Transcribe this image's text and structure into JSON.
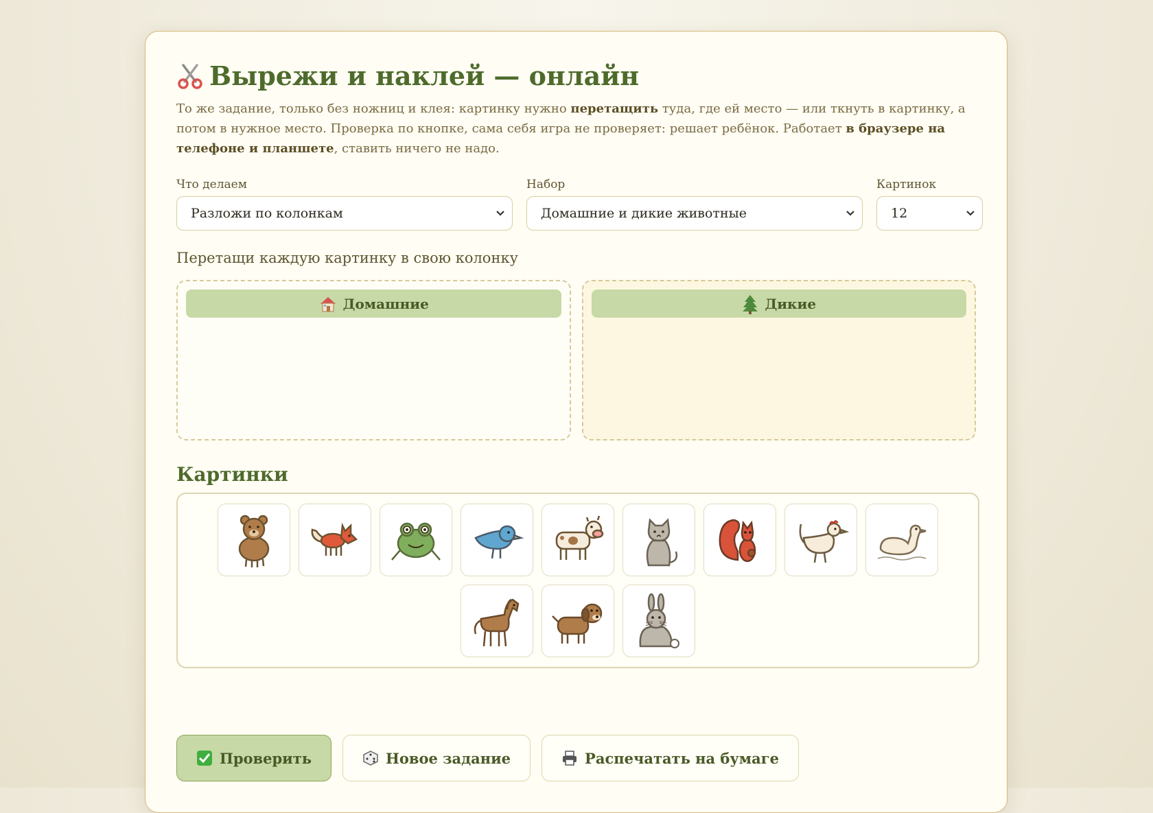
{
  "header": {
    "title": "Вырежи и наклей — онлайн",
    "icon": "scissors-icon"
  },
  "intro": {
    "p1": "То же задание, только без ножниц и клея: картинку нужно ",
    "b1": "перетащить",
    "p2": " туда, где ей место — или ткнуть в картинку, а потом в нужное место. Проверка по кнопке, сама себя игра не проверяет: решает ребёнок. Работает ",
    "b2": "в браузере на телефоне и планшете",
    "p3": ", ставить ничего не надо."
  },
  "controls": {
    "mode": {
      "label": "Что делаем",
      "value": "Разложи по колонкам"
    },
    "set": {
      "label": "Набор",
      "value": "Домашние и дикие животные"
    },
    "count": {
      "label": "Картинок",
      "value": "12"
    }
  },
  "task": "Перетащи каждую картинку в свою колонку",
  "columns": [
    {
      "label": "Домашние",
      "icon": "house-icon"
    },
    {
      "label": "Дикие",
      "icon": "tree-icon"
    }
  ],
  "pool": {
    "title": "Картинки",
    "items": [
      "bear",
      "fox",
      "frog",
      "bird",
      "cow",
      "cat",
      "squirrel",
      "hen",
      "duck",
      "horse",
      "dog",
      "rabbit"
    ]
  },
  "buttons": {
    "check": "Проверить",
    "new_task": "Новое задание",
    "print": "Распечатать на бумаге"
  },
  "colors": {
    "accent": "#4e6b2c",
    "column_header": "#c7d9a6",
    "card_border": "#d6b97a"
  }
}
